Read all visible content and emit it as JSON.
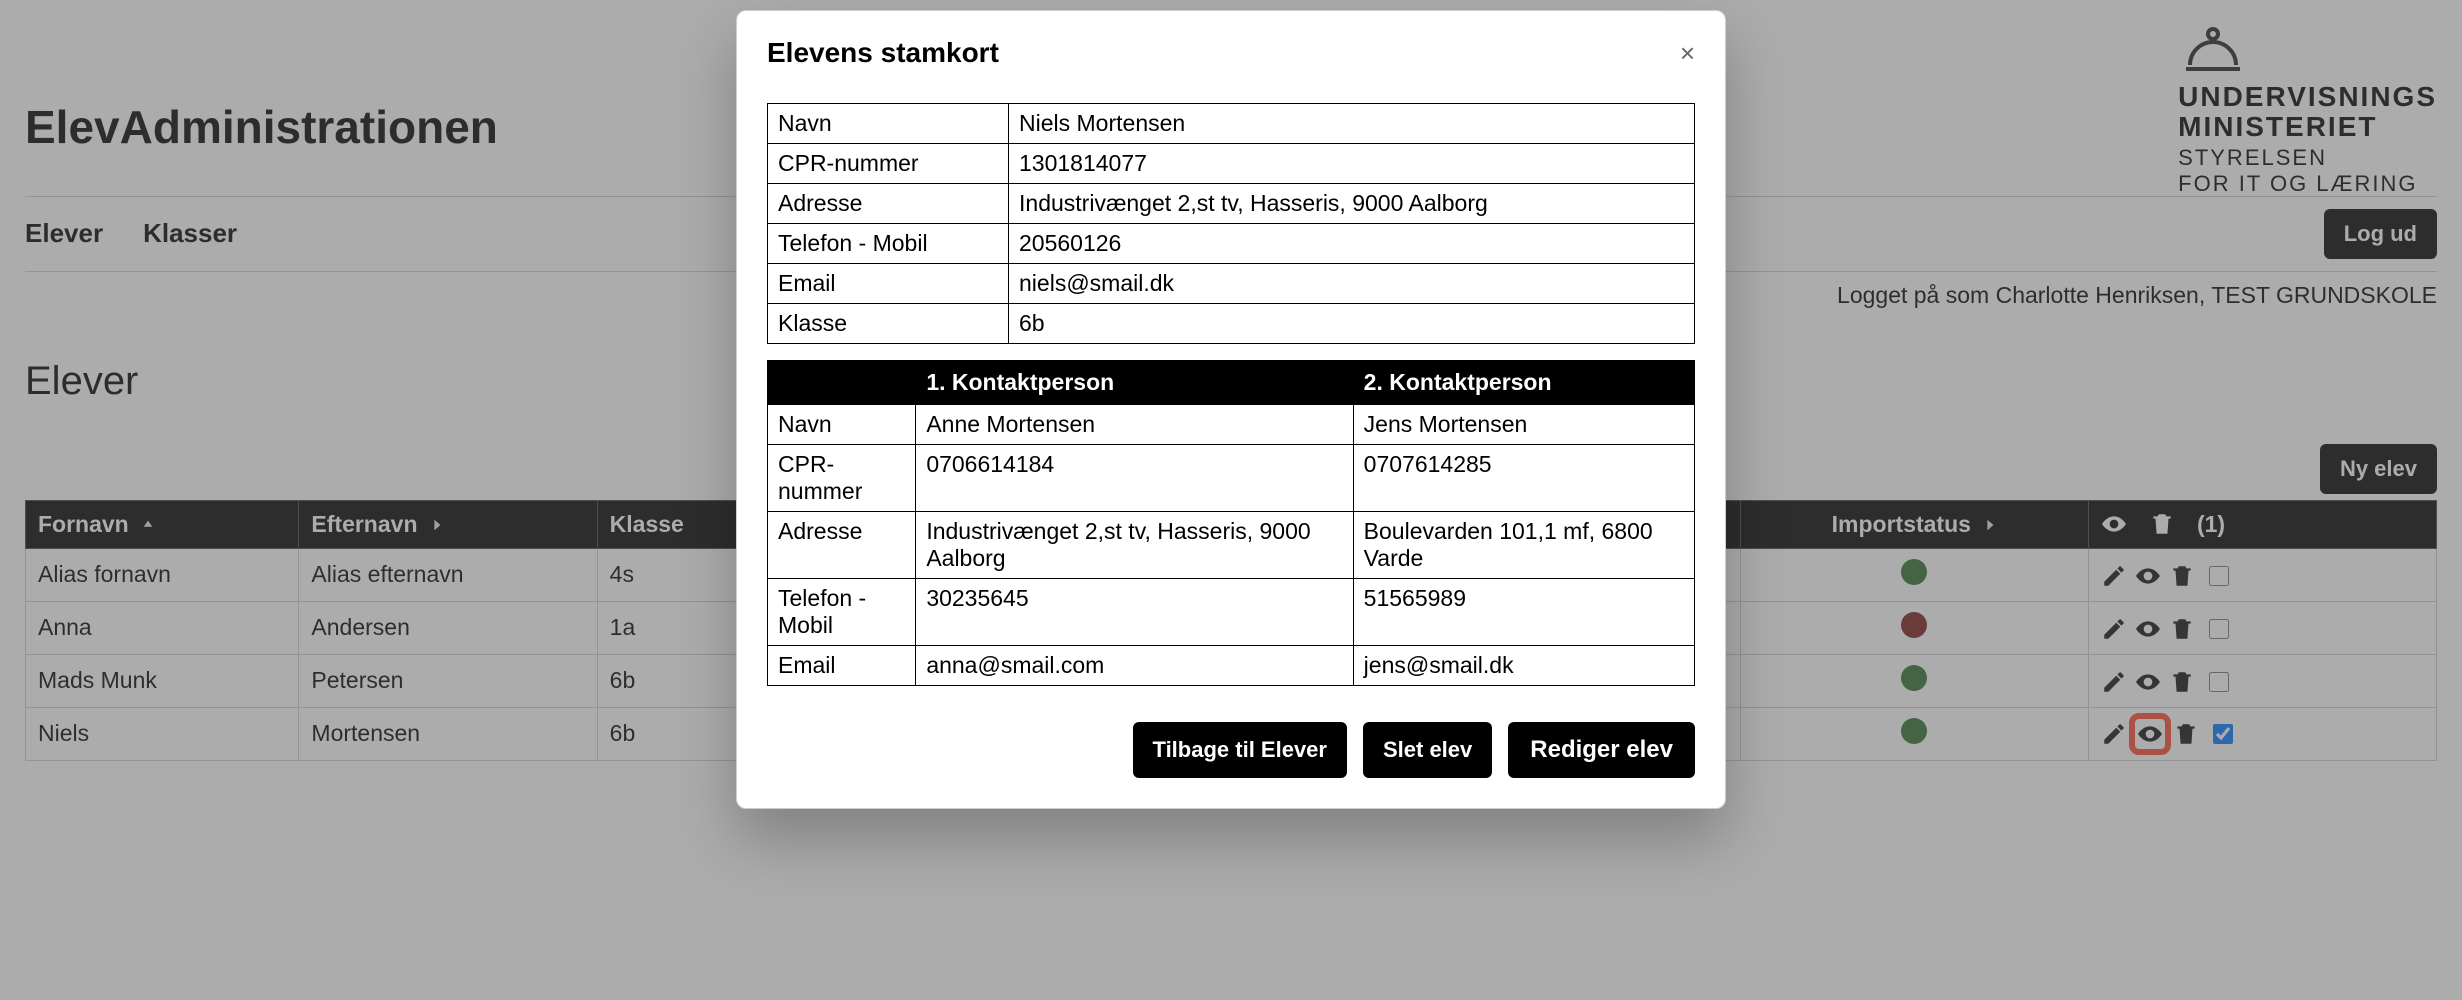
{
  "page": {
    "title": "ElevAdministrationen",
    "logo": {
      "line1": "UNDERVISNINGS",
      "line2": "MINISTERIET",
      "line3": "STYRELSEN",
      "line4": "FOR IT OG LÆRING"
    },
    "nav": {
      "item1": "Elever",
      "item2": "Klasser",
      "logout": "Log ud"
    },
    "status": "Logget på som Charlotte Henriksen, TEST GRUNDSKOLE",
    "section_title": "Elever",
    "new_button": "Ny elev"
  },
  "table": {
    "headers": {
      "fornavn": "Fornavn",
      "efternavn": "Efternavn",
      "klasse": "Klasse",
      "kontakt1": "",
      "kontakt2": "",
      "import": "Importstatus",
      "actions_count": "(1)"
    },
    "rows": [
      {
        "fornavn": "Alias fornavn",
        "efternavn": "Alias efternavn",
        "klasse": "4s",
        "k1": "",
        "k2": "",
        "import": "green",
        "checked": false,
        "highlight": false
      },
      {
        "fornavn": "Anna",
        "efternavn": "Andersen",
        "klasse": "1a",
        "k1": "",
        "k2": "",
        "import": "red",
        "checked": false,
        "highlight": false
      },
      {
        "fornavn": "Mads Munk",
        "efternavn": "Petersen",
        "klasse": "6b",
        "k1": "",
        "k2": "",
        "import": "green",
        "checked": false,
        "highlight": false
      },
      {
        "fornavn": "Niels",
        "efternavn": "Mortensen",
        "klasse": "6b",
        "k1": "Anne Mortensen",
        "k2": "Jens Mortensen",
        "import": "green",
        "checked": true,
        "highlight": true
      }
    ]
  },
  "modal": {
    "title": "Elevens stamkort",
    "labels": {
      "navn": "Navn",
      "cpr": "CPR-nummer",
      "adresse": "Adresse",
      "tlf": "Telefon - Mobil",
      "email": "Email",
      "klasse": "Klasse",
      "cpr2": "CPR-nummer"
    },
    "student": {
      "navn": "Niels Mortensen",
      "cpr": "1301814077",
      "adresse": "Industrivænget 2,st tv, Hasseris, 9000 Aalborg",
      "tlf": "20560126",
      "email": "niels@smail.dk",
      "klasse": "6b"
    },
    "contacts": {
      "header1": "1. Kontaktperson",
      "header2": "2. Kontaktperson",
      "c1": {
        "navn": "Anne Mortensen",
        "cpr": "0706614184",
        "adresse": "Industrivænget 2,st tv, Hasseris, 9000 Aalborg",
        "tlf": "30235645",
        "email": "anna@smail.com"
      },
      "c2": {
        "navn": "Jens Mortensen",
        "cpr": "0707614285",
        "adresse": "Boulevarden 101,1 mf, 6800 Varde",
        "tlf": "51565989",
        "email": "jens@smail.dk"
      }
    },
    "buttons": {
      "back": "Tilbage til Elever",
      "delete": "Slet elev",
      "edit": "Rediger elev"
    }
  }
}
